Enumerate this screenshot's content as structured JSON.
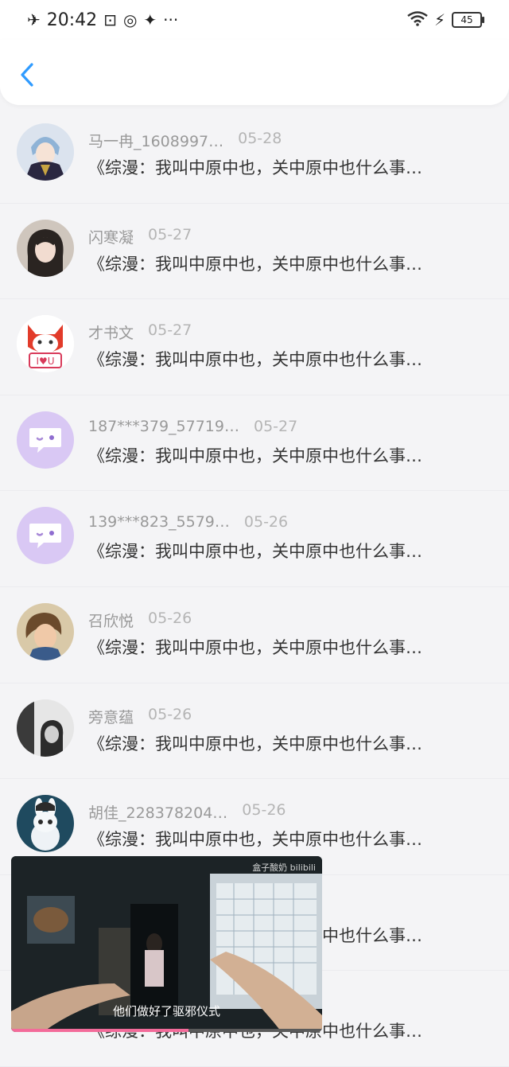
{
  "status_bar": {
    "time": "20:42",
    "battery": "45"
  },
  "header": {
    "back_icon": "chevron-left-icon"
  },
  "items": [
    {
      "author": "马一冉_1608997…",
      "date": "05-28",
      "title": "《综漫：我叫中原中也，关中原中也什么事…",
      "avatar": "anime-boy"
    },
    {
      "author": "闪寒凝",
      "date": "05-27",
      "title": "《综漫：我叫中原中也，关中原中也什么事…",
      "avatar": "girl-photo"
    },
    {
      "author": "才书文",
      "date": "05-27",
      "title": "《综漫：我叫中原中也，关中原中也什么事…",
      "avatar": "fox-iou"
    },
    {
      "author": "187***379_57719…",
      "date": "05-27",
      "title": "《综漫：我叫中原中也，关中原中也什么事…",
      "avatar": "chat-bubble"
    },
    {
      "author": "139***823_5579…",
      "date": "05-26",
      "title": "《综漫：我叫中原中也，关中原中也什么事…",
      "avatar": "chat-bubble"
    },
    {
      "author": "召欣悦",
      "date": "05-26",
      "title": "《综漫：我叫中原中也，关中原中也什么事…",
      "avatar": "kid-photo"
    },
    {
      "author": "旁意蕴",
      "date": "05-26",
      "title": "《综漫：我叫中原中也，关中原中也什么事…",
      "avatar": "bw-photo"
    },
    {
      "author": "胡佳_228378204…",
      "date": "05-26",
      "title": "《综漫：我叫中原中也，关中原中也什么事…",
      "avatar": "bunny"
    },
    {
      "author": "",
      "date": "",
      "title": "《综漫：我叫中原中也，关中原中也什么事…",
      "avatar": ""
    },
    {
      "author": "",
      "date": "",
      "title": "《综漫：我叫中原中也，关中原中也什么事…",
      "avatar": ""
    }
  ],
  "video": {
    "caption": "他们做好了驱邪仪式",
    "logo": "盒子酸奶 bilibili",
    "progress": 0.57
  },
  "colors": {
    "accent": "#2f9bff",
    "bubble_avatar": "#d9c8f4",
    "progress": "#f36b9a"
  }
}
